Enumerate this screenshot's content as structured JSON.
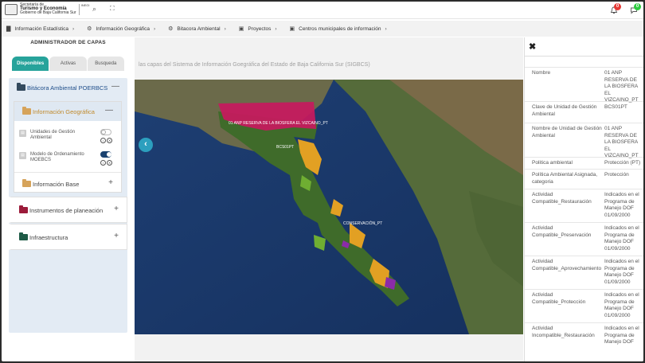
{
  "header": {
    "logo_line1": "Secretaría de",
    "logo_line2": "Turismo y Economía",
    "logo_line3": "Gobierno de Baja California Sur",
    "logo2_text": "INEGI",
    "notif1_count": "0",
    "notif1_color": "#e53935",
    "notif2_count": "0",
    "notif2_color": "#2ecc40"
  },
  "breadcrumb": [
    {
      "label": "Información Estadística",
      "icon": "bar-chart-icon"
    },
    {
      "label": "Información Geográfica",
      "icon": "globe-icon"
    },
    {
      "label": "Bitacora Ambiental",
      "icon": "globe-icon"
    },
    {
      "label": "Proyectos",
      "icon": "window-icon"
    },
    {
      "label": "Centros municipales de información",
      "icon": "window-icon"
    }
  ],
  "left_panel": {
    "title": "ADMINISTRADOR DE CAPAS",
    "tabs": [
      "Disponibles",
      "Activas",
      "Busqueda"
    ],
    "groups": [
      {
        "label": "Bitácora Ambiental POERBCS",
        "toggle": "—",
        "color": "#334a5e"
      },
      {
        "label": "Información Geográfica",
        "toggle": "—",
        "color": "#d6a35a"
      },
      {
        "label": "Información Base",
        "toggle": "+",
        "color": "#d6a35a"
      },
      {
        "label": "Instrumentos de planeación",
        "toggle": "+",
        "color": "#9b1b3a"
      },
      {
        "label": "Infraestructura",
        "toggle": "+",
        "color": "#1e5b46"
      }
    ],
    "layers": [
      {
        "label": "Unidades de Gestión Ambiental",
        "switch": "off"
      },
      {
        "label": "Modelo de Ordenamiento MOEBCS",
        "switch": "on"
      }
    ]
  },
  "map": {
    "title": "las capas del Sistema de Información Goegráfica del Estado de Baja California Sur (SIGBCS)",
    "labels": [
      "01 ANP RESERVA DE LA BIOSFERA EL VIZCAINO_PT",
      "BCS01PT",
      "CONSERVACIÓN_PT"
    ]
  },
  "details": [
    {
      "key": "Nombre",
      "value": "01 ANP RESERVA DE LA BIOSFERA EL VIZCAINO_PT"
    },
    {
      "key": "Clave de Unidad de Gestión Ambiental",
      "value": "BCS01PT"
    },
    {
      "key": "Nombre de Unidad de Gestión Ambiental",
      "value": "01 ANP RESERVA DE LA BIOSFERA EL VIZCAINO_PT"
    },
    {
      "key": "Politica ambiental",
      "value": "Protección (PT)"
    },
    {
      "key": "Política Ambiental Asignada, categoria",
      "value": "Protección"
    },
    {
      "key": "Actividad Compatible_Restauración",
      "value": "Indicados en el Programa de Manejo DOF 01/09/2000"
    },
    {
      "key": "Actividad Compatible_Preservación",
      "value": "Indicados en el Programa de Manejo DOF 01/09/2000"
    },
    {
      "key": "Actividad Compatible_Aprovechamiento",
      "value": "Indicados en el Programa de Manejo DOF 01/09/2000"
    },
    {
      "key": "Actividad Compatible_Protección",
      "value": "Indicados en el Programa de Manejo DOF 01/09/2000"
    },
    {
      "key": "Actividad Incompatible_Restauración",
      "value": "Indicados en el Programa de Manejo DOF"
    }
  ]
}
